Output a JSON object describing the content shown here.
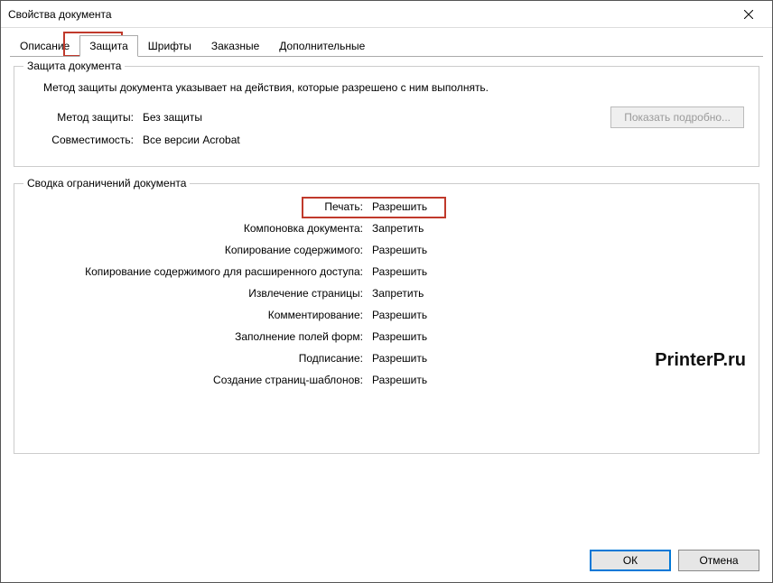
{
  "window": {
    "title": "Свойства документа"
  },
  "tabs": {
    "items": [
      {
        "label": "Описание"
      },
      {
        "label": "Защита"
      },
      {
        "label": "Шрифты"
      },
      {
        "label": "Заказные"
      },
      {
        "label": "Дополнительные"
      }
    ]
  },
  "security": {
    "legend": "Защита документа",
    "description": "Метод защиты документа указывает на действия, которые разрешено с ним выполнять.",
    "method_label": "Метод защиты:",
    "method_value": "Без защиты",
    "compat_label": "Совместимость:",
    "compat_value": "Все версии Acrobat",
    "details_button": "Показать подробно..."
  },
  "restrictions": {
    "legend": "Сводка ограничений документа",
    "rows": [
      {
        "label": "Печать:",
        "value": "Разрешить"
      },
      {
        "label": "Компоновка документа:",
        "value": "Запретить"
      },
      {
        "label": "Копирование содержимого:",
        "value": "Разрешить"
      },
      {
        "label": "Копирование содержимого для расширенного доступа:",
        "value": "Разрешить"
      },
      {
        "label": "Извлечение страницы:",
        "value": "Запретить"
      },
      {
        "label": "Комментирование:",
        "value": "Разрешить"
      },
      {
        "label": "Заполнение полей форм:",
        "value": "Разрешить"
      },
      {
        "label": "Подписание:",
        "value": "Разрешить"
      },
      {
        "label": "Создание страниц-шаблонов:",
        "value": "Разрешить"
      }
    ]
  },
  "watermark": "PrinterP.ru",
  "footer": {
    "ok": "ОК",
    "cancel": "Отмена"
  }
}
